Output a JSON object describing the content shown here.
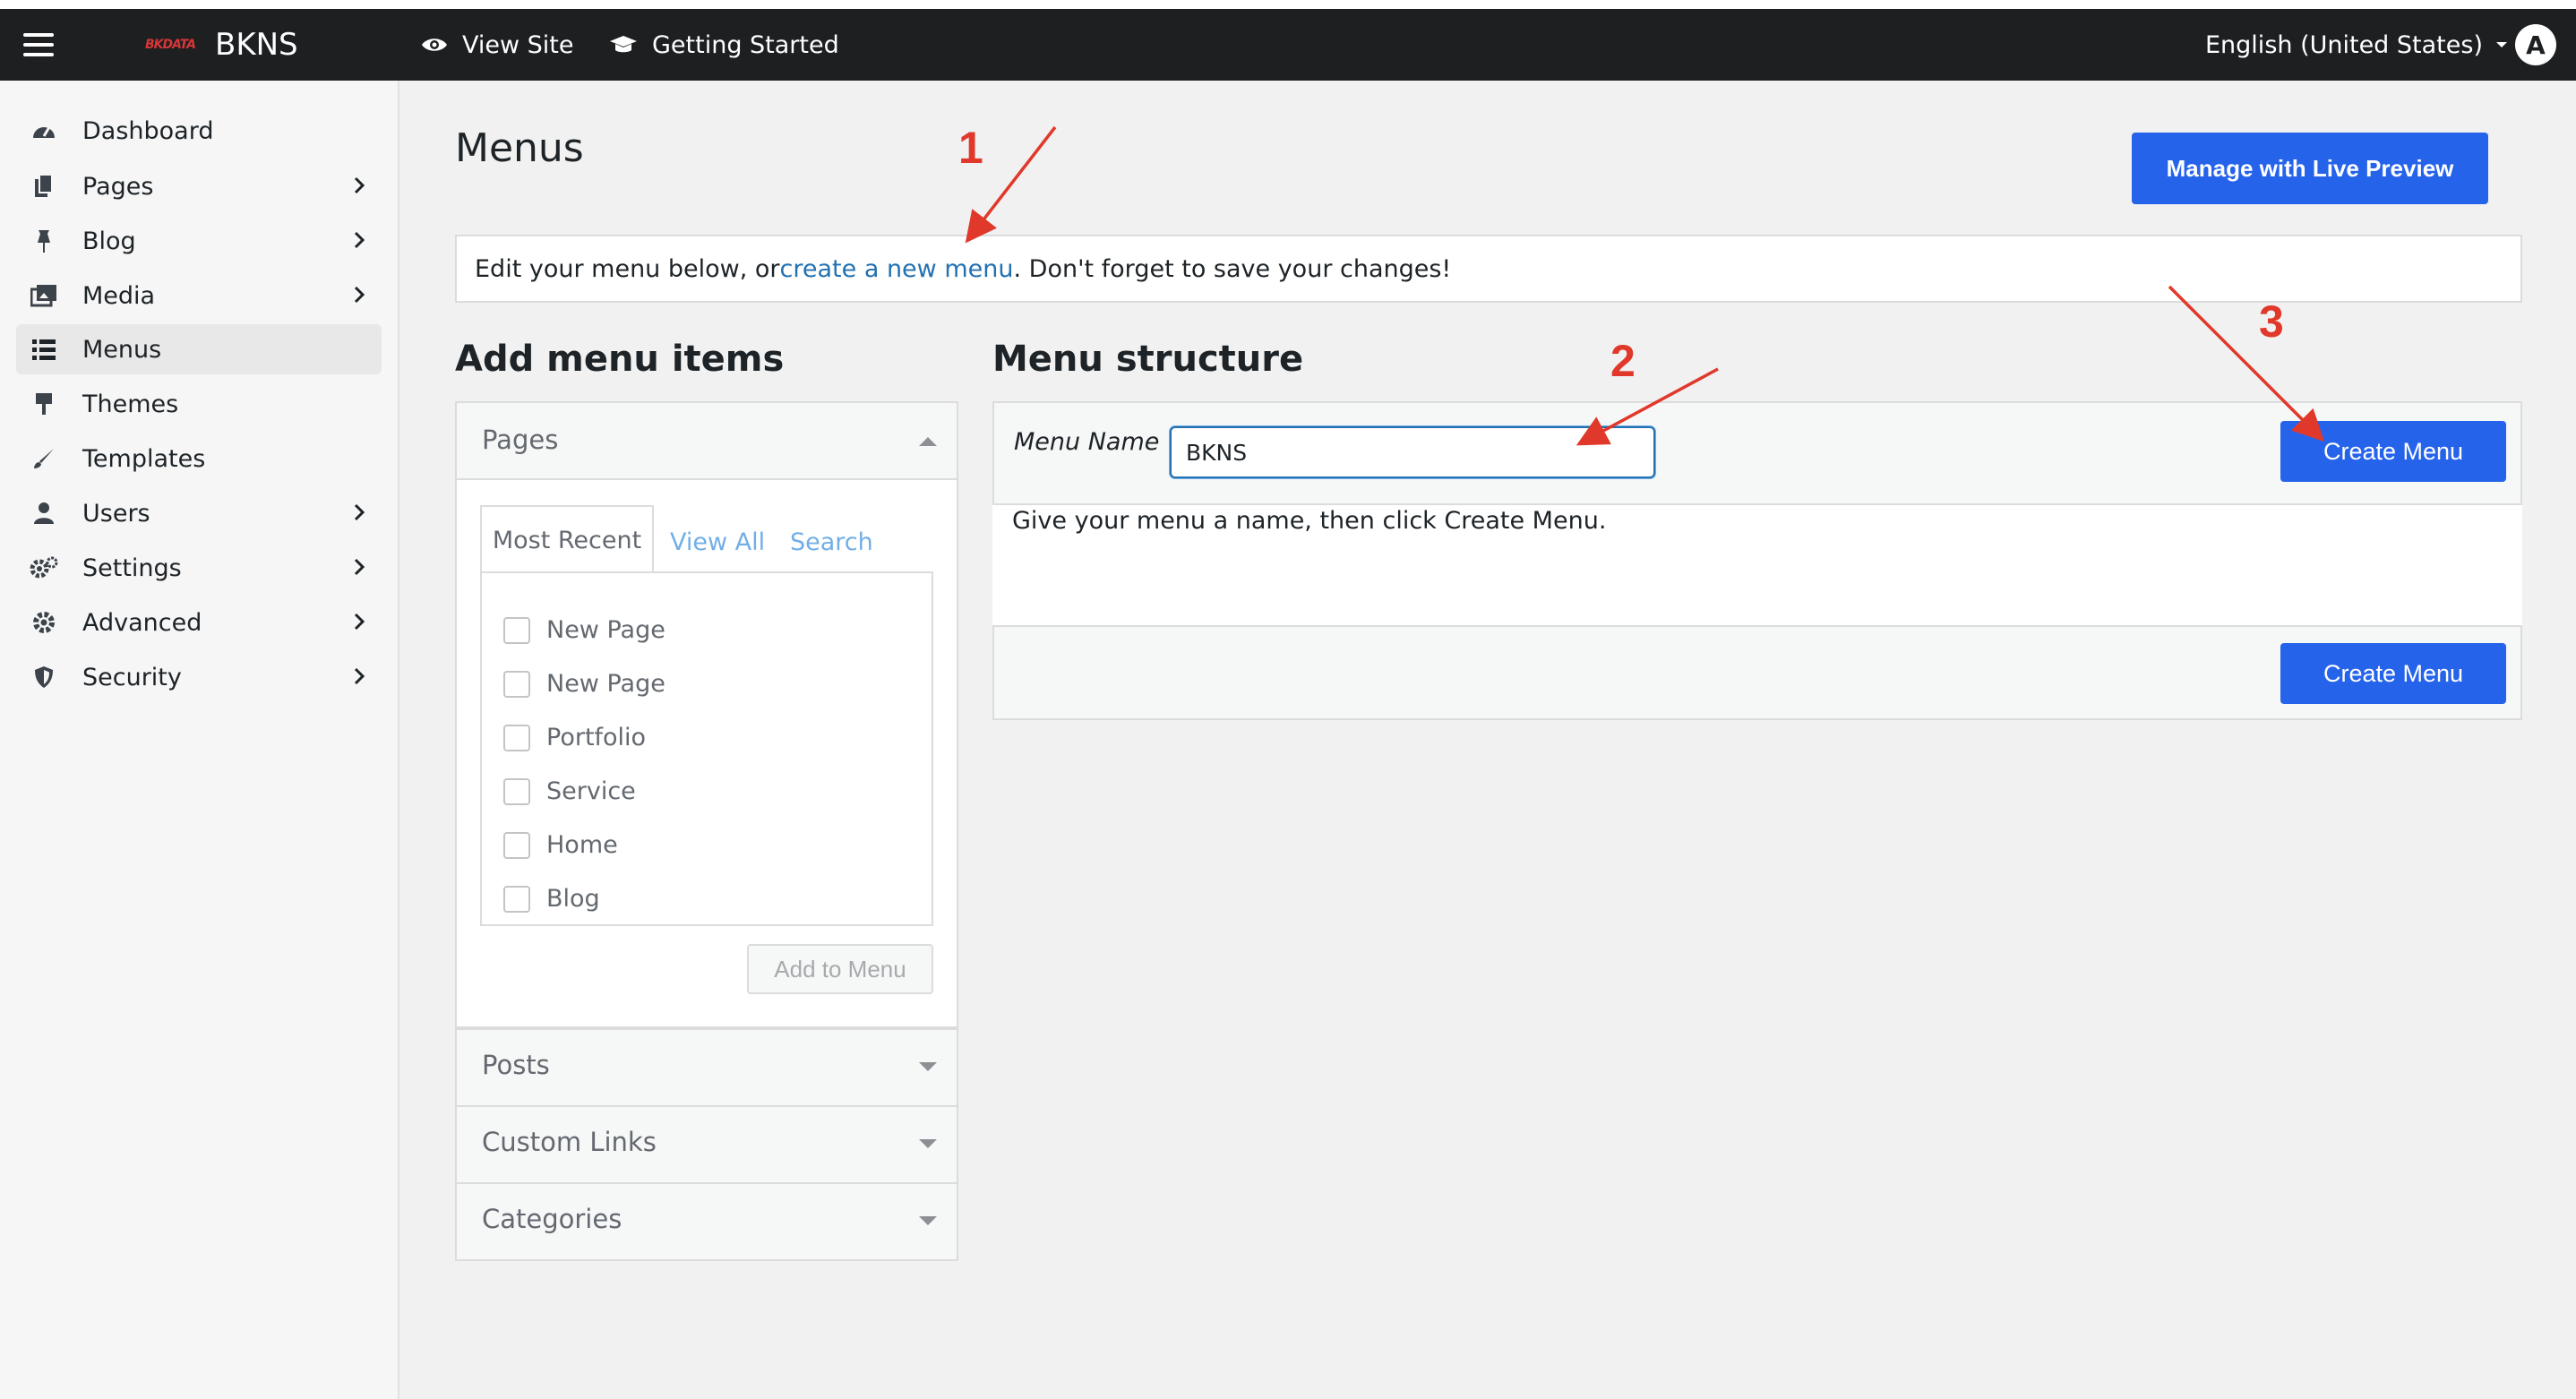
{
  "topbar": {
    "logo_text": "BKDATA",
    "site_name": "BKNS",
    "view_site": "View Site",
    "getting_started": "Getting Started",
    "language": "English (United States)",
    "avatar_letter": "A"
  },
  "sidebar": {
    "items": [
      {
        "label": "Dashboard",
        "icon": "dashboard-icon",
        "has_submenu": false
      },
      {
        "label": "Pages",
        "icon": "pages-icon",
        "has_submenu": true
      },
      {
        "label": "Blog",
        "icon": "pin-icon",
        "has_submenu": true
      },
      {
        "label": "Media",
        "icon": "media-icon",
        "has_submenu": true
      },
      {
        "label": "Menus",
        "icon": "menus-icon",
        "has_submenu": false,
        "active": true
      },
      {
        "label": "Themes",
        "icon": "brush-icon",
        "has_submenu": false
      },
      {
        "label": "Templates",
        "icon": "templates-icon",
        "has_submenu": false
      },
      {
        "label": "Users",
        "icon": "user-icon",
        "has_submenu": true
      },
      {
        "label": "Settings",
        "icon": "settings-icon",
        "has_submenu": true
      },
      {
        "label": "Advanced",
        "icon": "gear-icon",
        "has_submenu": true
      },
      {
        "label": "Security",
        "icon": "shield-icon",
        "has_submenu": true
      }
    ]
  },
  "main": {
    "title": "Menus",
    "live_preview_button": "Manage with Live Preview",
    "notice": {
      "before": "Edit your menu below, or ",
      "link": "create a new menu",
      "after": ". Don't forget to save your changes!"
    }
  },
  "add_items": {
    "heading": "Add menu items",
    "pages_panel": {
      "title": "Pages",
      "tabs": [
        "Most Recent",
        "View All",
        "Search"
      ],
      "items": [
        "New Page",
        "New Page",
        "Portfolio",
        "Service",
        "Home",
        "Blog"
      ],
      "add_button": "Add to Menu"
    },
    "collapsed_panels": [
      "Posts",
      "Custom Links",
      "Categories"
    ]
  },
  "structure": {
    "heading": "Menu structure",
    "name_label": "Menu Name",
    "name_value": "BKNS",
    "create_button": "Create Menu",
    "hint": "Give your menu a name, then click Create Menu."
  },
  "annotations": [
    "1",
    "2",
    "3"
  ],
  "colors": {
    "topbar": "#1d1f21",
    "primary_button": "#2563eb",
    "link": "#2271b1",
    "annotation": "#e0392b"
  }
}
